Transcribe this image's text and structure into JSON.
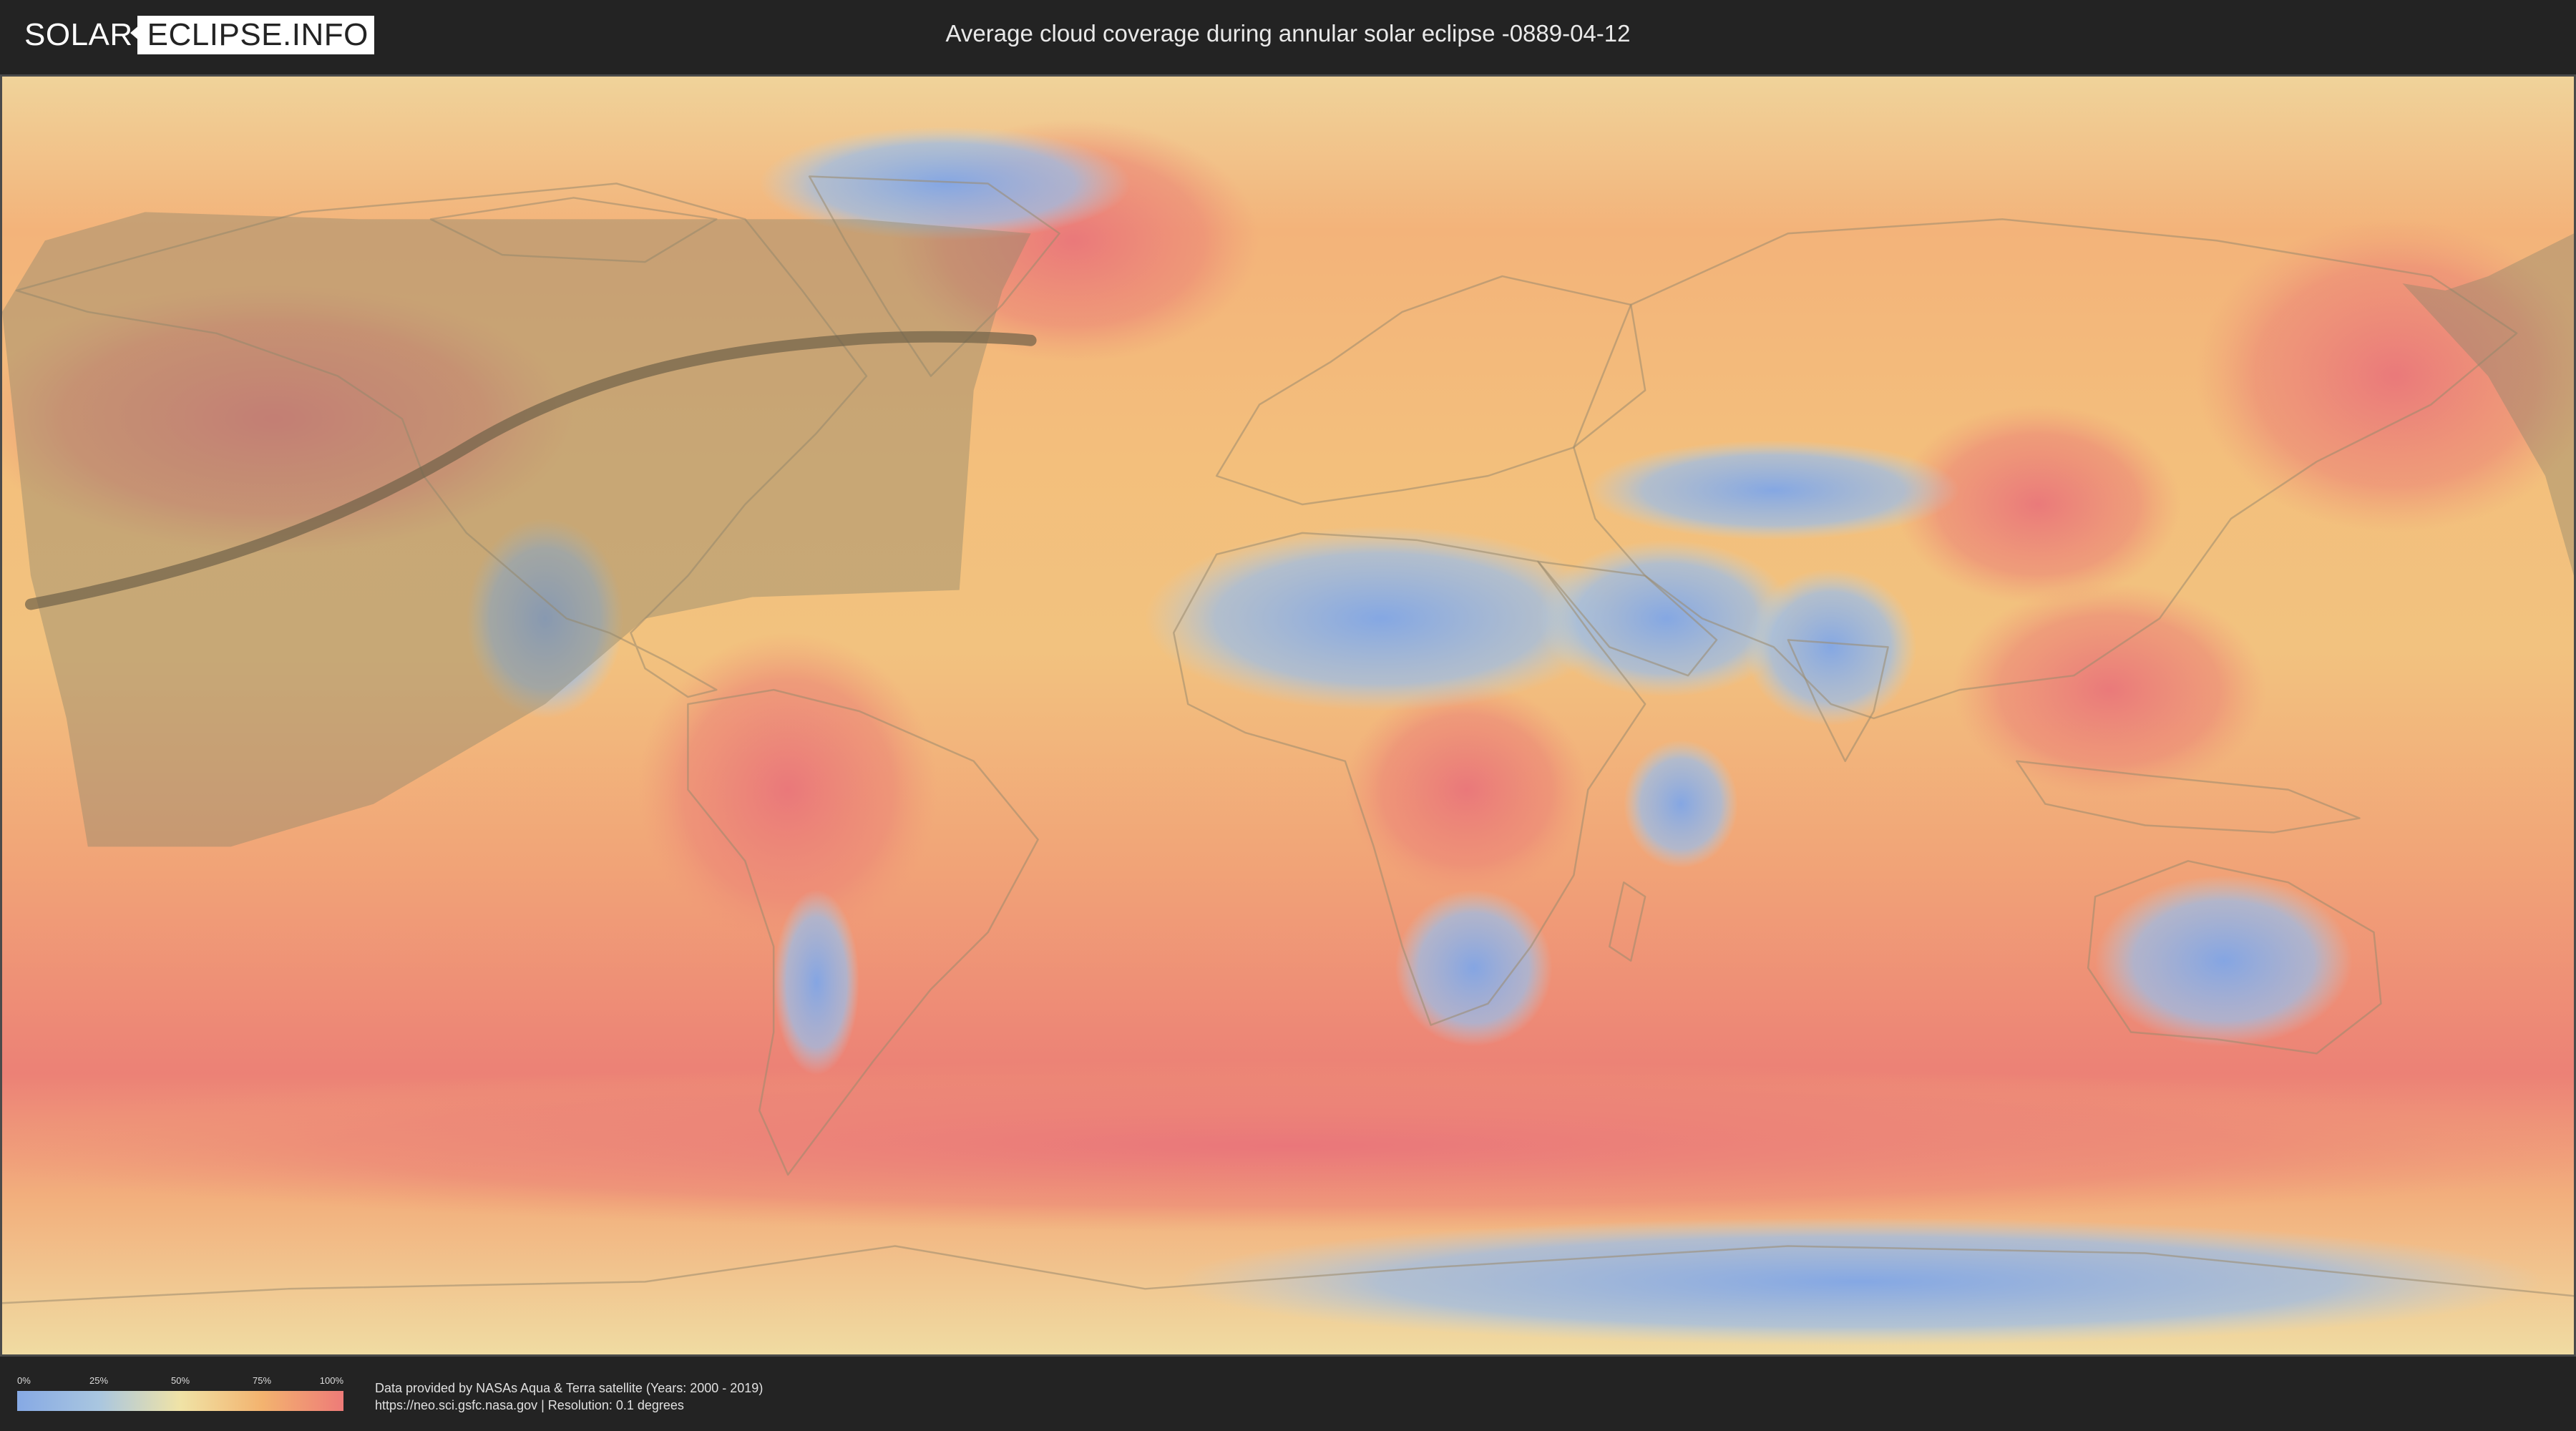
{
  "header": {
    "logo_part1": "SOLAR",
    "logo_part2": "ECLIPSE.INFO",
    "title": "Average cloud coverage during annular solar eclipse -0889-04-12"
  },
  "legend": {
    "ticks": [
      "0%",
      "25%",
      "50%",
      "75%",
      "100%"
    ],
    "colors": [
      "#86a9e4",
      "#a9c6e0",
      "#f0e3a6",
      "#f3b36f",
      "#ee7b78"
    ]
  },
  "footer": {
    "credit_line1": "Data provided by NASAs Aqua & Terra satellite (Years: 2000 - 2019)",
    "credit_line2": "https://neo.sci.gsfc.nasa.gov | Resolution: 0.1 degrees"
  },
  "map": {
    "projection": "equirectangular",
    "ocean_color": "#f2c07a",
    "high_cloud_color": "#ec8479",
    "low_cloud_color": "#8fb2e6",
    "visibility_zone_color": "#9c8e6e",
    "eclipse_path_color": "#6f6148"
  }
}
